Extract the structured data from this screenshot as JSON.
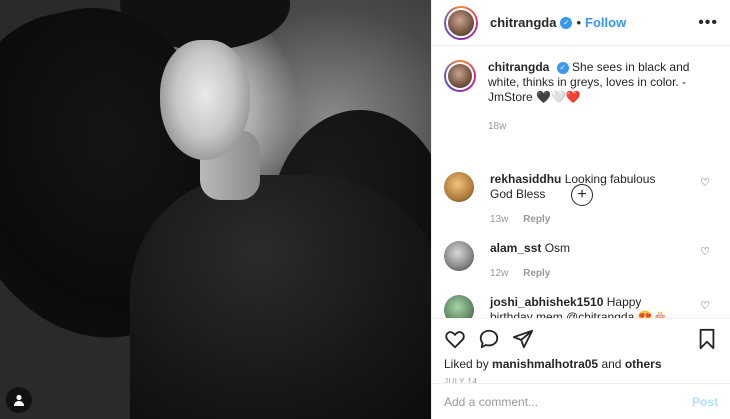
{
  "post": {
    "username": "chitrangda",
    "follow_label": "Follow",
    "dot": "•",
    "more": "•••"
  },
  "caption": {
    "username": "chitrangda",
    "text": "She sees in black and white, thinks in greys, loves in color. -JmStore 🖤🤍❤️",
    "time": "18w"
  },
  "comments": [
    {
      "username": "rekhasiddhu",
      "text": "Looking fabulous God Bless",
      "time": "13w",
      "reply": "Reply"
    },
    {
      "username": "alam_sst",
      "text": "Osm",
      "time": "12w",
      "reply": "Reply"
    },
    {
      "username": "joshi_abhishek1510",
      "text": "Happy birthday mem @chitrangda 😍🎂",
      "time": "",
      "reply": ""
    }
  ],
  "likes": {
    "prefix": "Liked by",
    "user": "manishmalhotra05",
    "joiner": "and",
    "others": "others"
  },
  "date": "JULY 14",
  "add_comment": {
    "placeholder": "Add a comment...",
    "post_label": "Post"
  },
  "colors": {
    "accent": "#3897f0",
    "post_disabled": "#b2dffc",
    "muted": "#999999"
  }
}
